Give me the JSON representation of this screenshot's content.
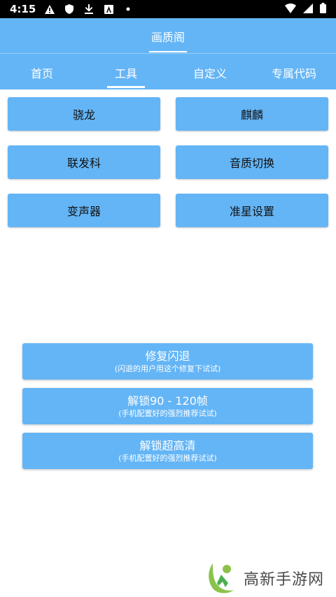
{
  "status_bar": {
    "time": "4:15",
    "icons": [
      "warning-icon",
      "shield-icon",
      "download-icon",
      "accessibility-icon",
      "dot-icon"
    ],
    "right_icons": [
      "wifi-icon",
      "signal-icon",
      "battery-icon"
    ]
  },
  "header": {
    "title": "画质阁"
  },
  "tabs": [
    {
      "label": "首页"
    },
    {
      "label": "工具"
    },
    {
      "label": "自定义"
    },
    {
      "label": "专属代码"
    }
  ],
  "grid_buttons": [
    {
      "label": "骁龙"
    },
    {
      "label": "麒麟"
    },
    {
      "label": "联发科"
    },
    {
      "label": "音质切换"
    },
    {
      "label": "变声器"
    },
    {
      "label": "准星设置"
    }
  ],
  "actions": [
    {
      "label": "修复闪退",
      "sub": "(闪退的用户用这个修复下试试)"
    },
    {
      "label": "解锁90 - 120帧",
      "sub": "(手机配置好的强烈推荐试试)"
    },
    {
      "label": "解锁超高清",
      "sub": "(手机配置好的强烈推荐试试)"
    }
  ],
  "watermark": {
    "text": "高新手游网"
  },
  "colors": {
    "accent": "#64b5f6",
    "status_bar": "#000000",
    "watermark_green": "#8bc34a"
  }
}
